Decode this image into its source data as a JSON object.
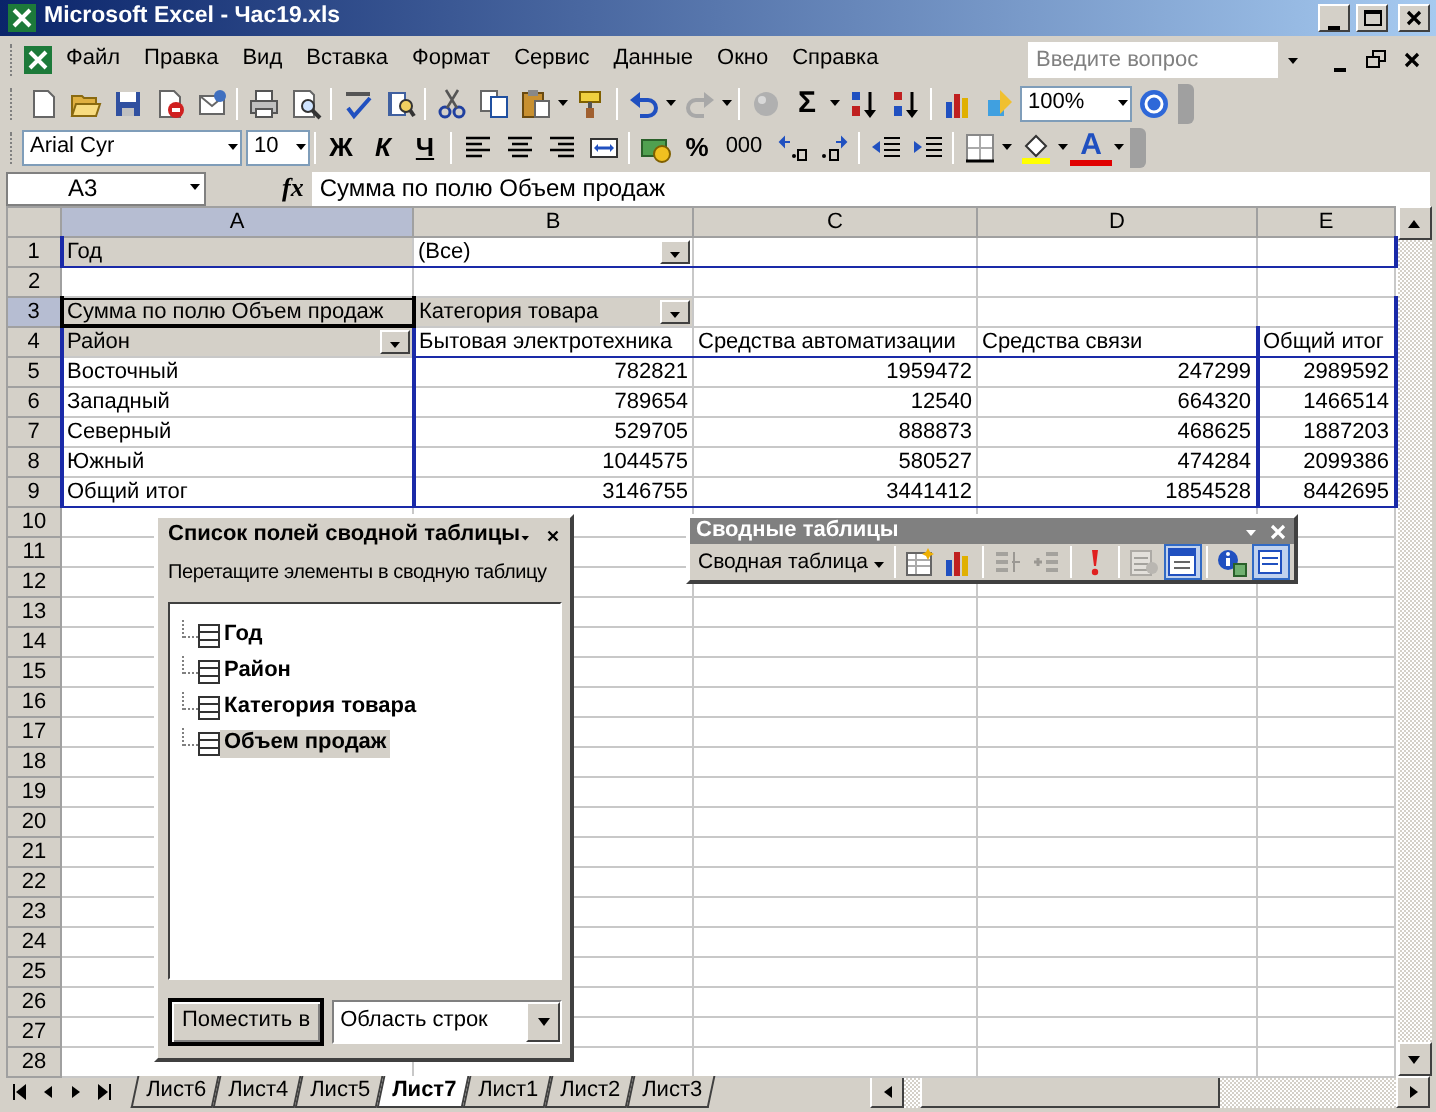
{
  "window": {
    "title": "Microsoft Excel - Час19.xls"
  },
  "menu": [
    "Файл",
    "Правка",
    "Вид",
    "Вставка",
    "Формат",
    "Сервис",
    "Данные",
    "Окно",
    "Справка"
  ],
  "help_box": {
    "placeholder": "Введите вопрос"
  },
  "standard_toolbar": {
    "sum": "Σ",
    "zoom": "100%"
  },
  "formatting_toolbar": {
    "font": "Arial Cyr",
    "size": "10",
    "style_buttons": [
      "Ж",
      "К",
      "Ч"
    ],
    "percent": "%",
    "thousands": "000",
    "font_color": "A"
  },
  "formula_bar": {
    "name_box": "A3",
    "function_label": "fx",
    "formula": "Сумма по полю Объем продаж"
  },
  "columns": [
    {
      "label": "A",
      "selected": true
    },
    {
      "label": "B",
      "selected": false
    },
    {
      "label": "C",
      "selected": false
    },
    {
      "label": "D",
      "selected": false
    },
    {
      "label": "E",
      "selected": false
    }
  ],
  "row_numbers": [
    {
      "label": "1",
      "selected": false
    },
    {
      "label": "2",
      "selected": false
    },
    {
      "label": "3",
      "selected": true
    },
    {
      "label": "4",
      "selected": false
    },
    {
      "label": "5",
      "selected": false
    },
    {
      "label": "6",
      "selected": false
    },
    {
      "label": "7",
      "selected": false
    },
    {
      "label": "8",
      "selected": false
    },
    {
      "label": "9",
      "selected": false
    },
    {
      "label": "10",
      "selected": false
    },
    {
      "label": "11",
      "selected": false
    },
    {
      "label": "12",
      "selected": false
    },
    {
      "label": "13",
      "selected": false
    },
    {
      "label": "14",
      "selected": false
    },
    {
      "label": "15",
      "selected": false
    },
    {
      "label": "16",
      "selected": false
    },
    {
      "label": "17",
      "selected": false
    },
    {
      "label": "18",
      "selected": false
    },
    {
      "label": "19",
      "selected": false
    },
    {
      "label": "20",
      "selected": false
    },
    {
      "label": "21",
      "selected": false
    },
    {
      "label": "22",
      "selected": false
    },
    {
      "label": "23",
      "selected": false
    },
    {
      "label": "24",
      "selected": false
    },
    {
      "label": "25",
      "selected": false
    },
    {
      "label": "26",
      "selected": false
    },
    {
      "label": "27",
      "selected": false
    },
    {
      "label": "28",
      "selected": false
    }
  ],
  "pivot": {
    "page_field": {
      "name": "Год",
      "value": "(Все)"
    },
    "data_field": {
      "text": "Сумма по полю Объем продаж",
      "active": true
    },
    "column_field": "Категория товара",
    "row_field": "Район",
    "column_items": [
      "Бытовая электротехника",
      "Средства автоматизации",
      "Средства связи"
    ],
    "grand_total_label": "Общий итог",
    "rows": [
      {
        "label": "Восточный",
        "values": [
          "782821",
          "1959472",
          "247299",
          "2989592"
        ]
      },
      {
        "label": "Западный",
        "values": [
          "789654",
          "12540",
          "664320",
          "1466514"
        ]
      },
      {
        "label": "Северный",
        "values": [
          "529705",
          "888873",
          "468625",
          "1887203"
        ]
      },
      {
        "label": "Южный",
        "values": [
          "1044575",
          "580527",
          "474284",
          "2099386"
        ]
      },
      {
        "label": "Общий итог",
        "values": [
          "3146755",
          "3441412",
          "1854528",
          "8442695"
        ]
      }
    ]
  },
  "field_list": {
    "title": "Список полей сводной таблицы",
    "instruction": "Перетащите элементы в сводную таблицу",
    "fields": [
      {
        "label": "Год",
        "selected": false
      },
      {
        "label": "Район",
        "selected": false
      },
      {
        "label": "Категория товара",
        "selected": false
      },
      {
        "label": "Объем продаж",
        "selected": true
      }
    ],
    "add_button": "Поместить в",
    "area": "Область строк"
  },
  "pivot_toolbar": {
    "title": "Сводные таблицы",
    "menu": "Сводная таблица",
    "buttons": [
      {
        "pressed": false,
        "disabled": false
      },
      {
        "pressed": false,
        "disabled": false
      },
      {
        "pressed": false,
        "disabled": true
      },
      {
        "pressed": false,
        "disabled": true
      },
      {
        "pressed": false,
        "disabled": false
      },
      {
        "pressed": false,
        "disabled": true
      },
      {
        "pressed": true,
        "disabled": false
      },
      {
        "pressed": false,
        "disabled": false
      },
      {
        "pressed": true,
        "disabled": false
      }
    ]
  },
  "sheet_tabs": [
    {
      "label": "Лист6",
      "selected": false
    },
    {
      "label": "Лист4",
      "selected": false
    },
    {
      "label": "Лист5",
      "selected": false
    },
    {
      "label": "Лист7",
      "selected": true
    },
    {
      "label": "Лист1",
      "selected": false
    },
    {
      "label": "Лист2",
      "selected": false
    },
    {
      "label": "Лист3",
      "selected": false
    }
  ]
}
